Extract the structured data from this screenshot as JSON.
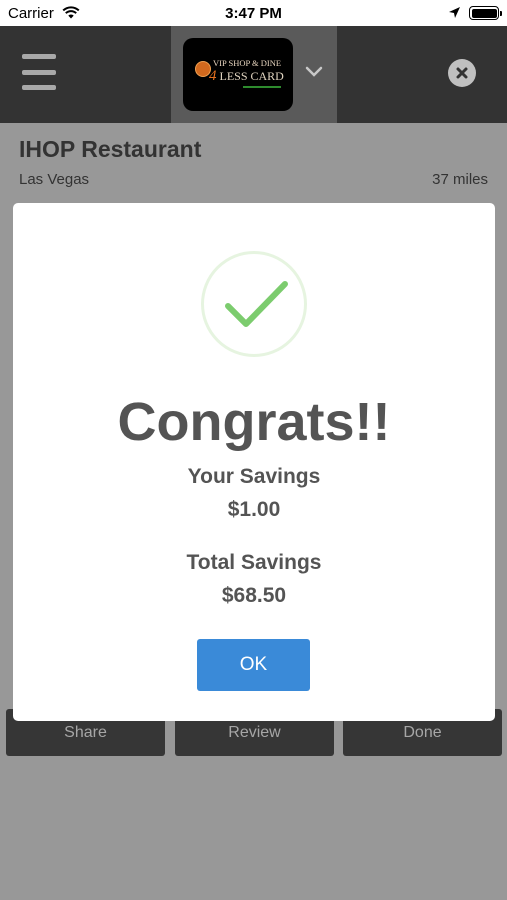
{
  "status_bar": {
    "carrier": "Carrier",
    "time": "3:47 PM"
  },
  "header": {
    "logo": {
      "line1": "VIP SHOP & DINE",
      "line2_number": "4",
      "line2_rest": " LESS CARD"
    }
  },
  "restaurant": {
    "name": "IHOP Restaurant",
    "city": "Las Vegas",
    "distance": "37 miles"
  },
  "actions": {
    "share_label": "Share",
    "review_label": "Review",
    "done_label": "Done"
  },
  "modal": {
    "title": "Congrats!!",
    "your_savings_label": "Your Savings",
    "your_savings_value": "$1.00",
    "total_savings_label": "Total Savings",
    "total_savings_value": "$68.50",
    "ok_label": "OK"
  },
  "colors": {
    "header_bg": "#333333",
    "brand_area_bg": "#5a5a5a",
    "overlay_bg": "#989898",
    "ok_button": "#3a8ad8",
    "check_green": "#7ccc6e"
  }
}
